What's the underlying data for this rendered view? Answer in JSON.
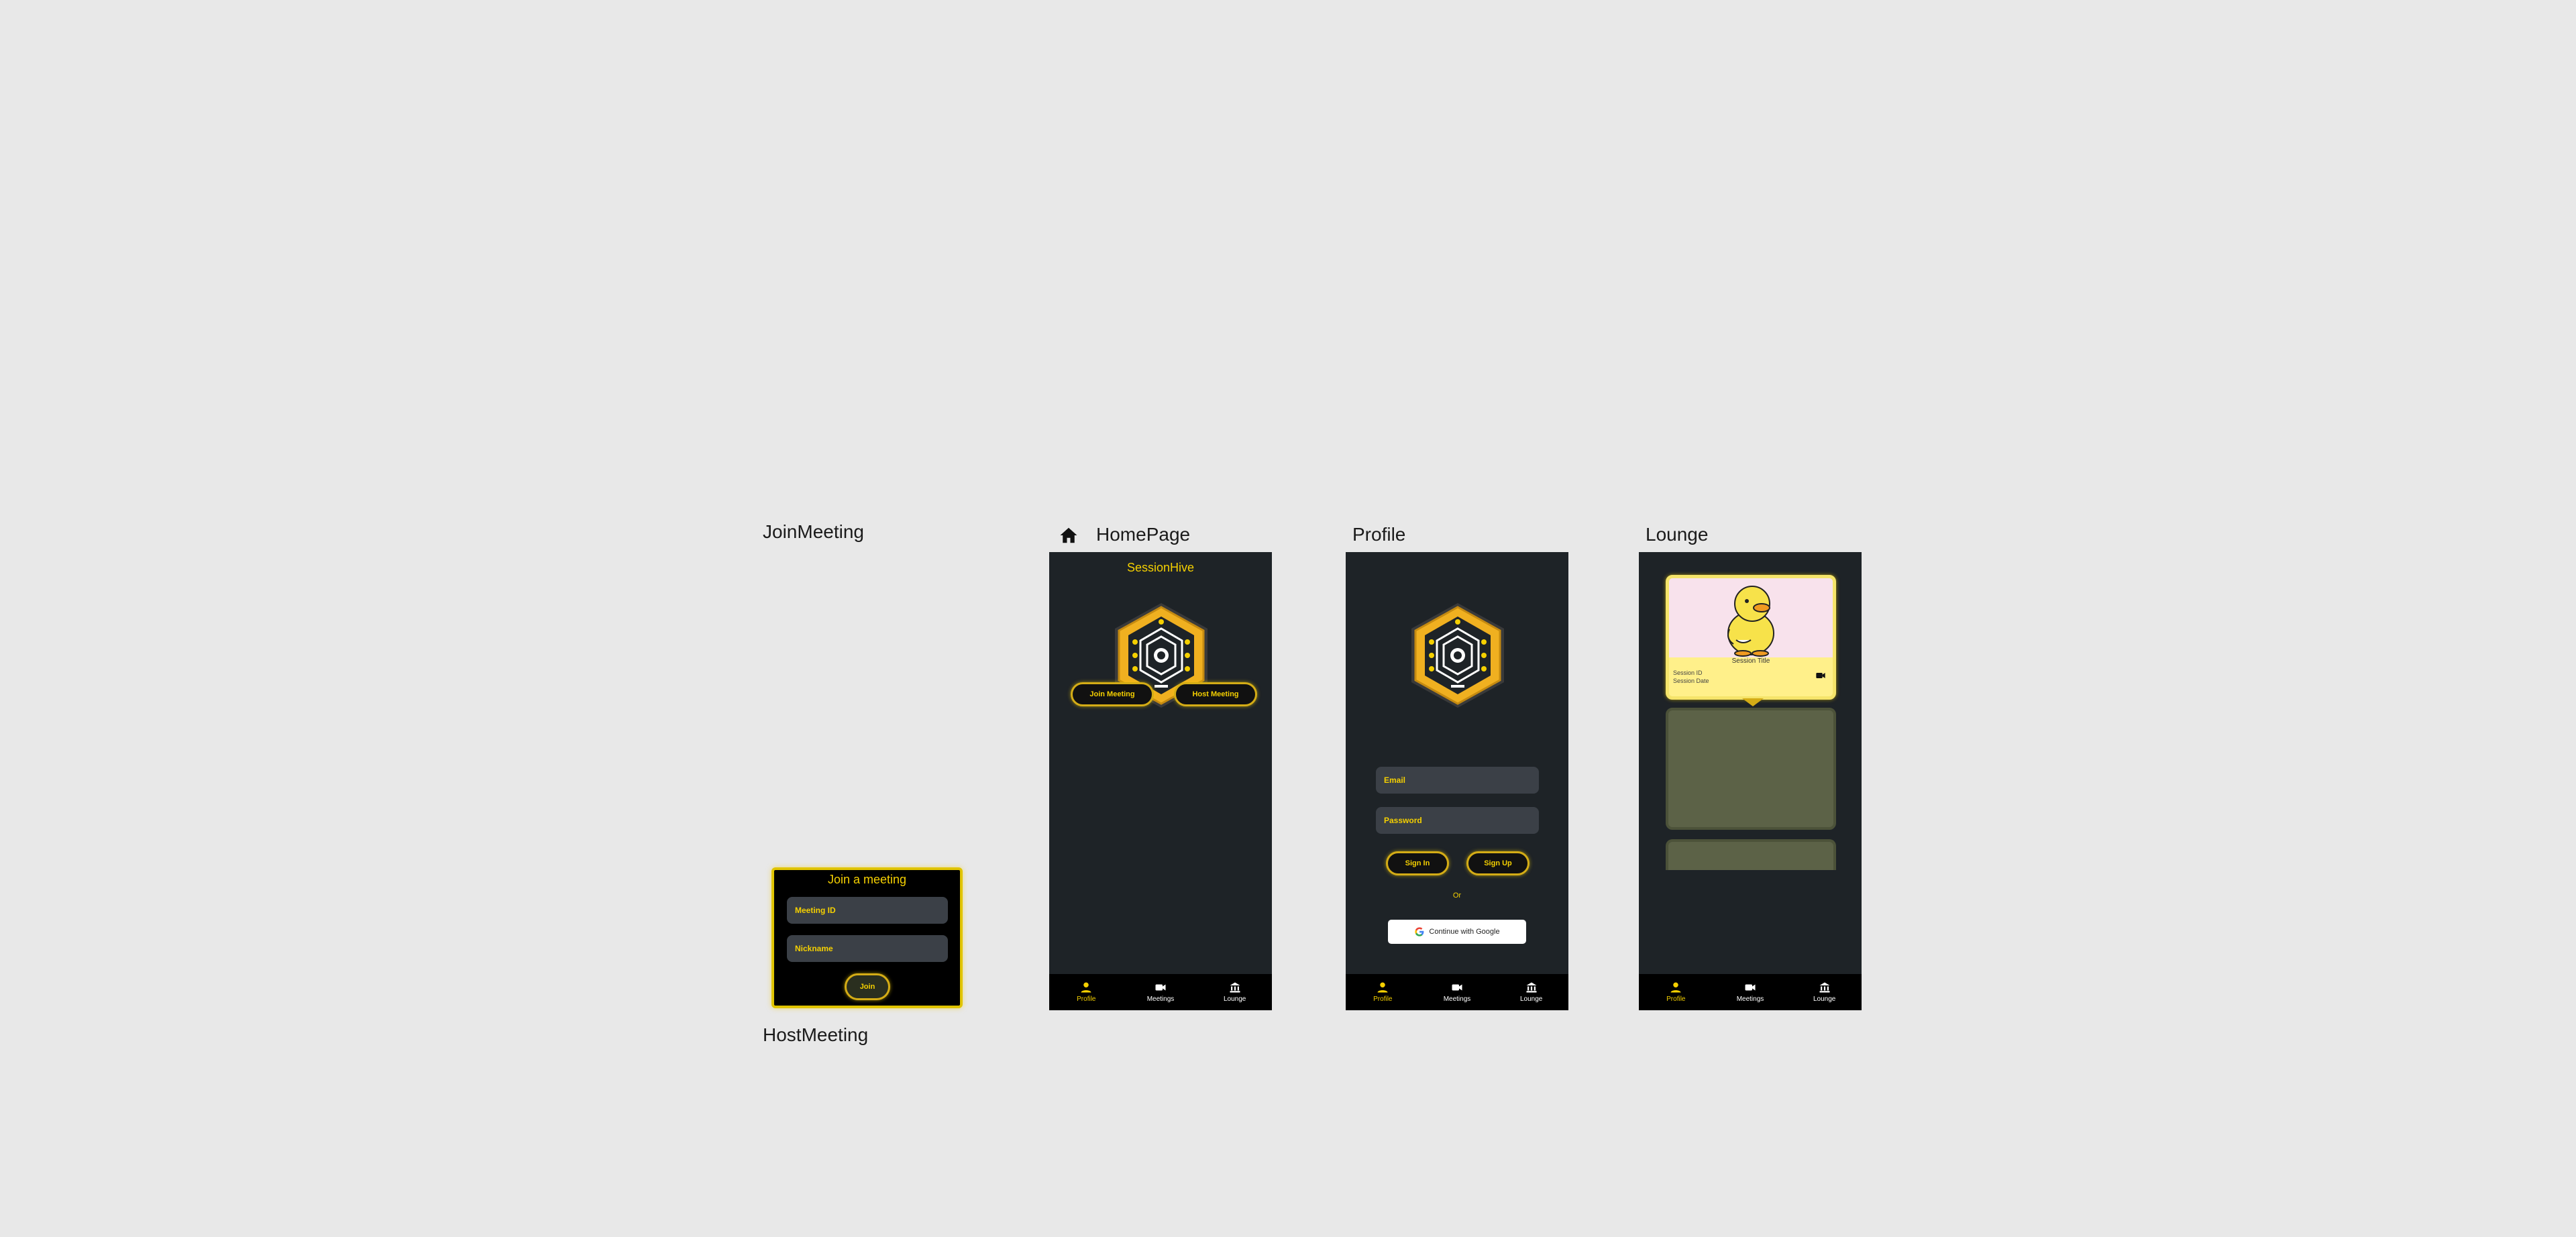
{
  "frames": {
    "join_meeting": "JoinMeeting",
    "host_meeting": "HostMeeting",
    "homepage": "HomePage",
    "profile": "Profile",
    "lounge": "Lounge"
  },
  "join_dialog": {
    "title": "Join a meeting",
    "meeting_id_placeholder": "Meeting ID",
    "nickname_placeholder": "Nickname",
    "join_label": "Join"
  },
  "homepage": {
    "app_title": "SessionHive",
    "join_button": "Join Meeting",
    "host_button": "Host Meeting"
  },
  "profile": {
    "email_placeholder": "Email",
    "password_placeholder": "Password",
    "sign_in": "Sign In",
    "sign_up": "Sign Up",
    "or": "Or",
    "google": "Continue with Google"
  },
  "lounge": {
    "card_title": "Session Title",
    "session_id": "Session ID",
    "session_date": "Session Date"
  },
  "nav": {
    "profile": "Profile",
    "meetings": "Meetings",
    "lounge": "Lounge"
  },
  "colors": {
    "accent": "#f5d000",
    "background": "#1e2327",
    "nav": "#000000",
    "canvas": "#e8e8e8",
    "card_yellow": "#fff08a",
    "card_pink": "#f8e2ec",
    "card_olive": "#5c6247"
  },
  "icons": [
    "home-icon",
    "person-icon",
    "video-camera-icon",
    "bank-icon",
    "google-icon"
  ]
}
